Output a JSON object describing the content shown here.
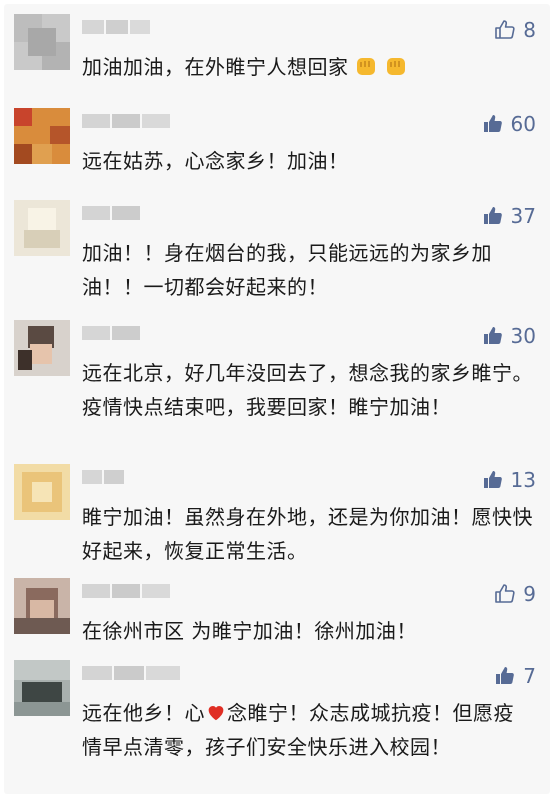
{
  "comments": [
    {
      "likes": "8",
      "liked": false,
      "text": "加油加油，在外睢宁人想回家",
      "emoji": "fist-emoji-icon"
    },
    {
      "likes": "60",
      "liked": true,
      "text": "远在姑苏，心念家乡！加油！"
    },
    {
      "likes": "37",
      "liked": true,
      "text": "加油！！身在烟台的我，只能远远的为家乡加油！！一切都会好起来的！"
    },
    {
      "likes": "30",
      "liked": true,
      "text": "远在北京，好几年没回去了，想念我的家乡睢宁。疫情快点结束吧，我要回家！睢宁加油！"
    },
    {
      "likes": "13",
      "liked": true,
      "text": "睢宁加油！虽然身在外地，还是为你加油！愿快快好起来，恢复正常生活。"
    },
    {
      "likes": "9",
      "liked": false,
      "text": "在徐州市区 为睢宁加油！徐州加油！"
    },
    {
      "likes": "7",
      "liked": true,
      "text_before": "远在他乡！心",
      "text_after": "念睢宁！众志成城抗疫！但愿疫情早点清零，孩子们安全快乐进入校园！",
      "emoji": "red-heart-icon"
    }
  ],
  "colors": {
    "like_blue": "#576b95",
    "text": "#1a1a1a",
    "panel": "#f7f7f7",
    "heart": "#e02e24",
    "fist": "#f5b82e"
  }
}
